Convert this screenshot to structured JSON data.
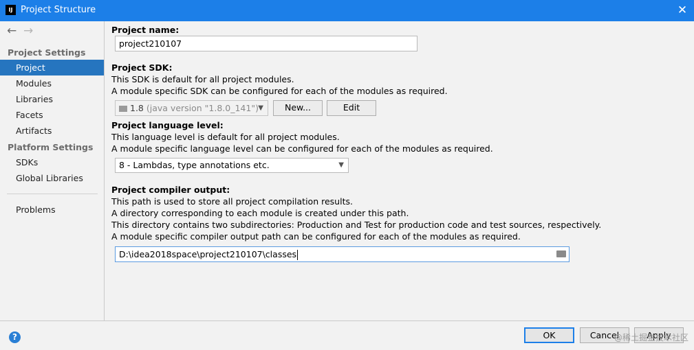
{
  "window": {
    "title": "Project Structure",
    "close": "✕"
  },
  "nav": {
    "back": "←",
    "forward": "→"
  },
  "sidebar": {
    "project_settings_header": "Project Settings",
    "project_items": [
      "Project",
      "Modules",
      "Libraries",
      "Facets",
      "Artifacts"
    ],
    "platform_settings_header": "Platform Settings",
    "platform_items": [
      "SDKs",
      "Global Libraries"
    ],
    "problems": "Problems",
    "selected": "Project"
  },
  "project_name": {
    "label": "Project name:",
    "value": "project210107"
  },
  "project_sdk": {
    "label": "Project SDK:",
    "desc1": "This SDK is default for all project modules.",
    "desc2": "A module specific SDK can be configured for each of the modules as required.",
    "selected_version": "1.8",
    "selected_detail": "(java version \"1.8.0_141\")",
    "new_button": "New...",
    "edit_button": "Edit"
  },
  "language_level": {
    "label": "Project language level:",
    "desc1": "This language level is default for all project modules.",
    "desc2": "A module specific language level can be configured for each of the modules as required.",
    "value": "8 - Lambdas, type annotations etc."
  },
  "compiler_output": {
    "label": "Project compiler output:",
    "desc1": "This path is used to store all project compilation results.",
    "desc2": "A directory corresponding to each module is created under this path.",
    "desc3": "This directory contains two subdirectories: Production and Test for production code and test sources, respectively.",
    "desc4": "A module specific compiler output path can be configured for each of the modules as required.",
    "value": "D:\\idea2018space\\project210107\\classes"
  },
  "dialog_buttons": {
    "help": "?",
    "ok": "OK",
    "cancel": "Cancel",
    "apply": "Apply"
  },
  "watermark": "@稀土掘金技术社区",
  "colors": {
    "titlebar": "#1c7fe8",
    "selection": "#2675bf"
  }
}
